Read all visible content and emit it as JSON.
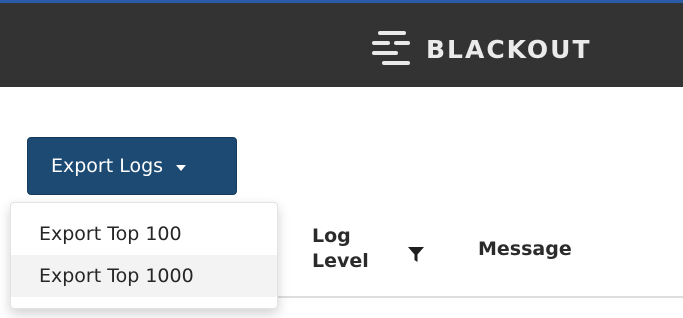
{
  "header": {
    "brand_name": "BLACKOUT",
    "brand_icon": "hamburger-lines-icon",
    "background_color": "#333333",
    "accent_color": "#2a5aa8"
  },
  "toolbar": {
    "export_label": "Export Logs",
    "export_button_color": "#1c4a73",
    "caret_icon": "caret-down-icon"
  },
  "export_menu": {
    "items": [
      {
        "label": "Export Top 100"
      },
      {
        "label": "Export Top 1000"
      }
    ]
  },
  "table": {
    "columns": [
      {
        "label": "Log Level",
        "filter_icon": "filter-icon"
      },
      {
        "label": "Message"
      }
    ]
  }
}
